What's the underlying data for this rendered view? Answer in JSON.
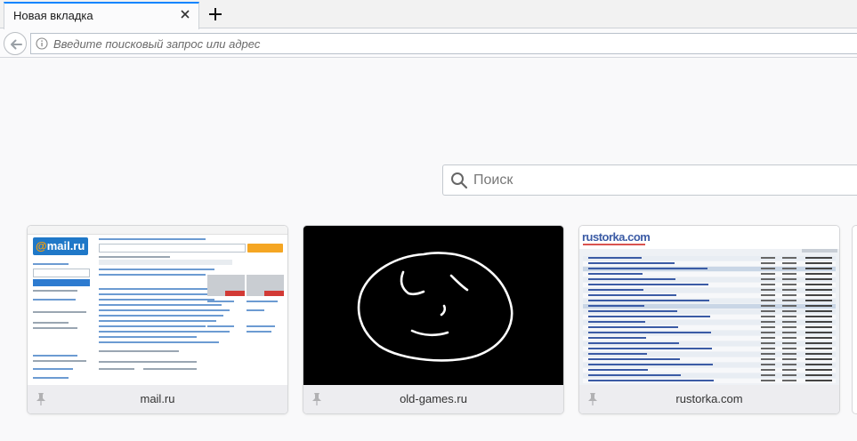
{
  "tab": {
    "title": "Новая вкладка"
  },
  "urlbar": {
    "placeholder": "Введите поисковый запрос или адрес"
  },
  "search": {
    "placeholder": "Поиск"
  },
  "tiles": [
    {
      "title": "mail.ru"
    },
    {
      "title": "old-games.ru"
    },
    {
      "title": "rustorka.com"
    }
  ],
  "mail_thumb": {
    "logo_text": "mail.ru"
  },
  "rustorka_thumb": {
    "logo_text": "rustorka.com"
  },
  "colors": {
    "accent": "#0a84ff",
    "tile_footer": "#ededf0",
    "page_bg": "#f9f9fa"
  }
}
